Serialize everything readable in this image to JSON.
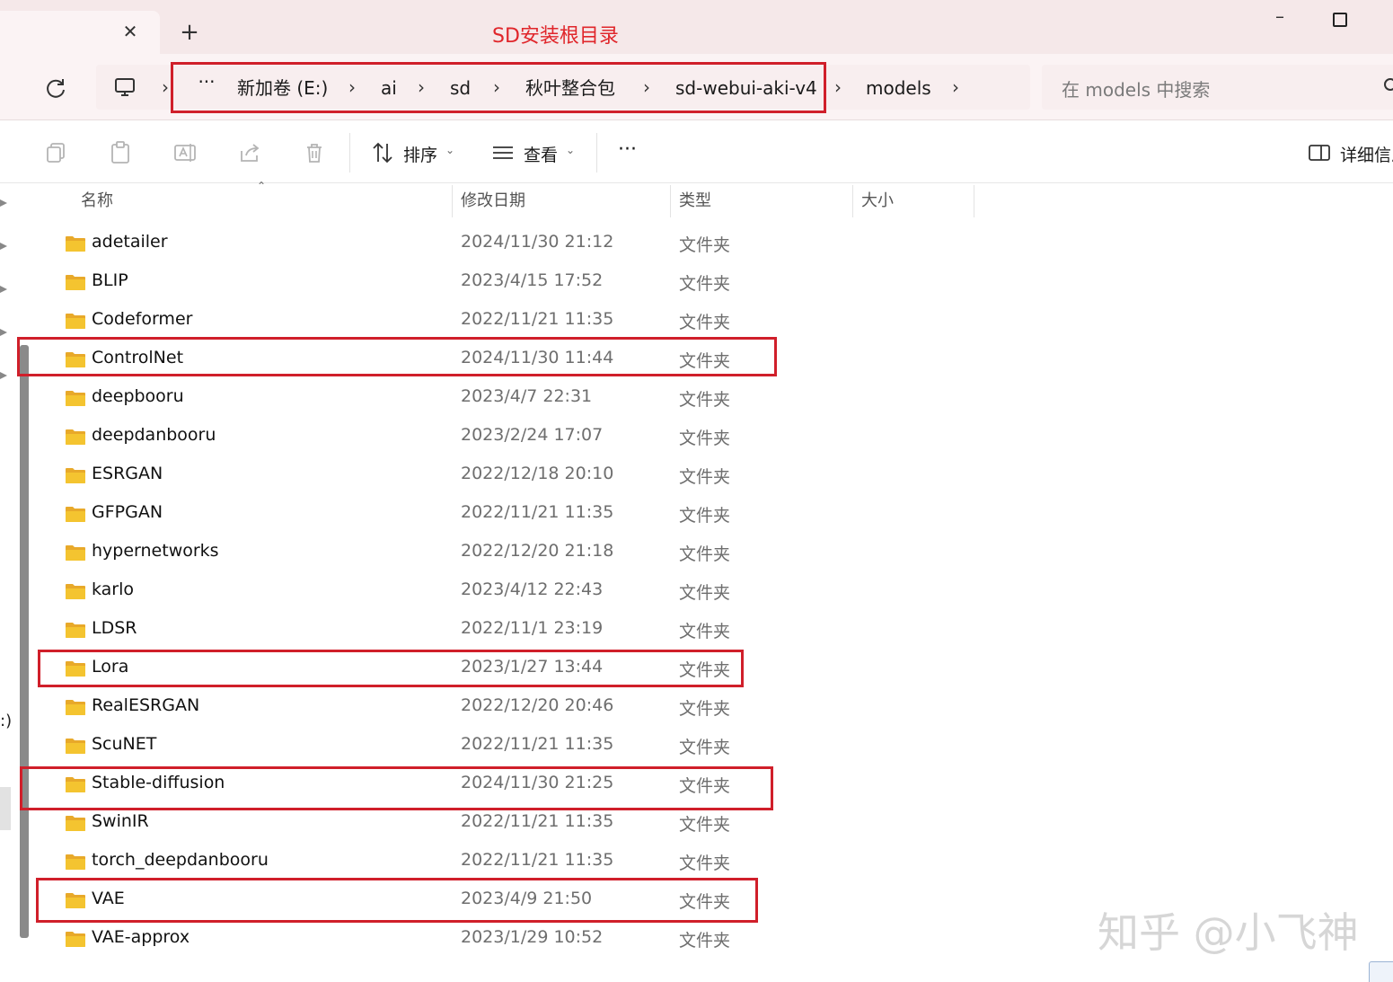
{
  "window": {
    "annotation_title": "SD安装根目录",
    "tab_close": "✕",
    "new_tab": "+"
  },
  "address_bar": {
    "overflow": "···",
    "separator": "›",
    "crumbs": [
      "新加卷 (E:)",
      "ai",
      "sd",
      "秋叶整合包",
      "sd-webui-aki-v4",
      "models"
    ],
    "search_placeholder": "在 models 中搜索"
  },
  "toolbar": {
    "sort_label": "排序",
    "view_label": "查看",
    "more": "···",
    "details_label": "详细信息"
  },
  "columns": {
    "name": "名称",
    "modified": "修改日期",
    "type": "类型",
    "size": "大小"
  },
  "sidebar_fragment": ":)",
  "files": [
    {
      "name": "adetailer",
      "modified": "2024/11/30 21:12",
      "type": "文件夹"
    },
    {
      "name": "BLIP",
      "modified": "2023/4/15 17:52",
      "type": "文件夹"
    },
    {
      "name": "Codeformer",
      "modified": "2022/11/21 11:35",
      "type": "文件夹"
    },
    {
      "name": "ControlNet",
      "modified": "2024/11/30 11:44",
      "type": "文件夹"
    },
    {
      "name": "deepbooru",
      "modified": "2023/4/7 22:31",
      "type": "文件夹"
    },
    {
      "name": "deepdanbooru",
      "modified": "2023/2/24 17:07",
      "type": "文件夹"
    },
    {
      "name": "ESRGAN",
      "modified": "2022/12/18 20:10",
      "type": "文件夹"
    },
    {
      "name": "GFPGAN",
      "modified": "2022/11/21 11:35",
      "type": "文件夹"
    },
    {
      "name": "hypernetworks",
      "modified": "2022/12/20 21:18",
      "type": "文件夹"
    },
    {
      "name": "karlo",
      "modified": "2023/4/12 22:43",
      "type": "文件夹"
    },
    {
      "name": "LDSR",
      "modified": "2022/11/1 23:19",
      "type": "文件夹"
    },
    {
      "name": "Lora",
      "modified": "2023/1/27 13:44",
      "type": "文件夹"
    },
    {
      "name": "RealESRGAN",
      "modified": "2022/12/20 20:46",
      "type": "文件夹"
    },
    {
      "name": "ScuNET",
      "modified": "2022/11/21 11:35",
      "type": "文件夹"
    },
    {
      "name": "Stable-diffusion",
      "modified": "2024/11/30 21:25",
      "type": "文件夹"
    },
    {
      "name": "SwinIR",
      "modified": "2022/11/21 11:35",
      "type": "文件夹"
    },
    {
      "name": "torch_deepdanbooru",
      "modified": "2022/11/21 11:35",
      "type": "文件夹"
    },
    {
      "name": "VAE",
      "modified": "2023/4/9 21:50",
      "type": "文件夹"
    },
    {
      "name": "VAE-approx",
      "modified": "2023/1/29 10:52",
      "type": "文件夹"
    }
  ],
  "watermark": "知乎 @小飞神",
  "colors": {
    "highlight_box": "#d01f2a",
    "annotation_text": "#e0262b",
    "folder_yellow": "#f4c430",
    "title_bar": "#f5e8e9"
  }
}
